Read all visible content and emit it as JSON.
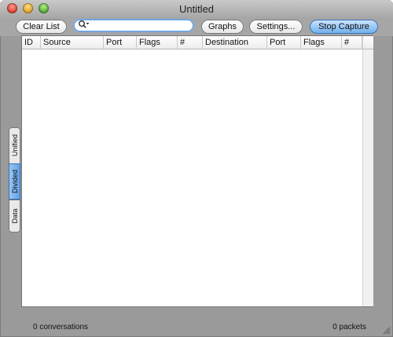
{
  "window": {
    "title": "Untitled"
  },
  "toolbar": {
    "clear_label": "Clear List",
    "graphs_label": "Graphs",
    "settings_label": "Settings...",
    "stop_label": "Stop Capture",
    "search": {
      "value": "",
      "placeholder": ""
    }
  },
  "side_tabs": [
    {
      "label": "Unified",
      "selected": false
    },
    {
      "label": "Divided",
      "selected": true
    },
    {
      "label": "Data",
      "selected": false
    }
  ],
  "table": {
    "columns": [
      "ID",
      "Source",
      "Port",
      "Flags",
      "#",
      "Destination",
      "Port",
      "Flags",
      "#"
    ],
    "rows": []
  },
  "status": {
    "conversations": "0 conversations",
    "packets": "0 packets"
  },
  "colors": {
    "accent": "#6aaeea",
    "window_bg": "#9a9a9a"
  },
  "icons": {
    "search": "magnifier-with-dropdown-icon",
    "resize": "resize-grip-icon"
  }
}
